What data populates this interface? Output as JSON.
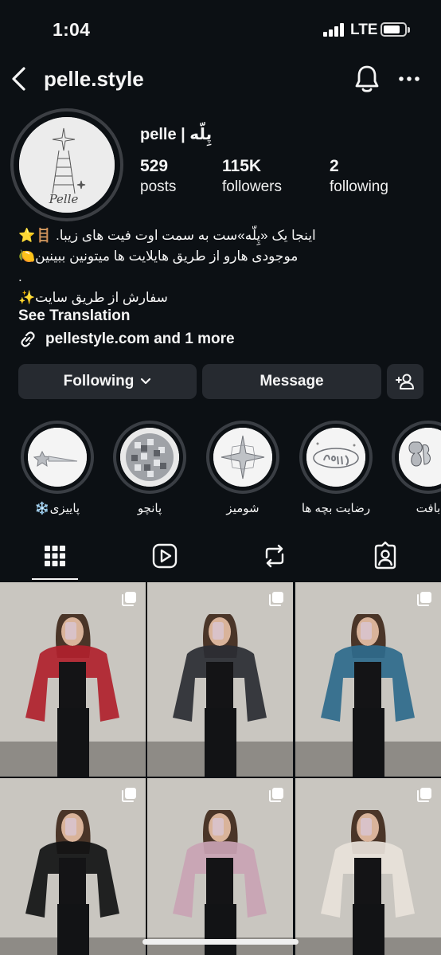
{
  "status_bar": {
    "time": "1:04",
    "network": "LTE"
  },
  "header": {
    "username": "pelle.style",
    "icons": [
      "back-chevron-icon",
      "bell-icon",
      "more-icon"
    ]
  },
  "profile": {
    "display_name": "pelle | پِلّه",
    "avatar_text": "Pelle",
    "stats": [
      {
        "value": "529",
        "label": "posts"
      },
      {
        "value": "115K",
        "label": "followers"
      },
      {
        "value": "2",
        "label": "following"
      }
    ],
    "bio_lines": [
      "اینجا یک «پِلّه»ست به سمت اوت فیت های زیبا. 🪜⭐️",
      "موجودی هارو از طریق هایلایت ها میتونین ببینین🍋",
      ".",
      "سفارش از طریق سایت✨"
    ],
    "see_translation": "See Translation",
    "link_text": "pellestyle.com and 1 more"
  },
  "actions": {
    "following_label": "Following",
    "message_label": "Message"
  },
  "highlights": [
    {
      "label": "پاییزی❄️",
      "icon": "shooting-star-icon"
    },
    {
      "label": "پانچو",
      "icon": "disco-ball-icon"
    },
    {
      "label": "شومیز",
      "icon": "sparkle-star-icon"
    },
    {
      "label": "رضایت بچه ها",
      "icon": "happy-text-icon"
    },
    {
      "label": "بافت",
      "icon": "balloon-letters-icon"
    }
  ],
  "tabs": [
    "grid-icon",
    "reels-icon",
    "reposts-icon",
    "tagged-icon"
  ],
  "colors": {
    "background": "#0c1014",
    "button": "#262a30",
    "text": "#f5f5f5"
  },
  "posts": [
    {
      "garment": "#b0212c"
    },
    {
      "garment": "#2a2d33"
    },
    {
      "garment": "#2e6a8c"
    },
    {
      "garment": "#111214"
    },
    {
      "garment": "#c9a3b4"
    },
    {
      "garment": "#e8e2da"
    }
  ]
}
